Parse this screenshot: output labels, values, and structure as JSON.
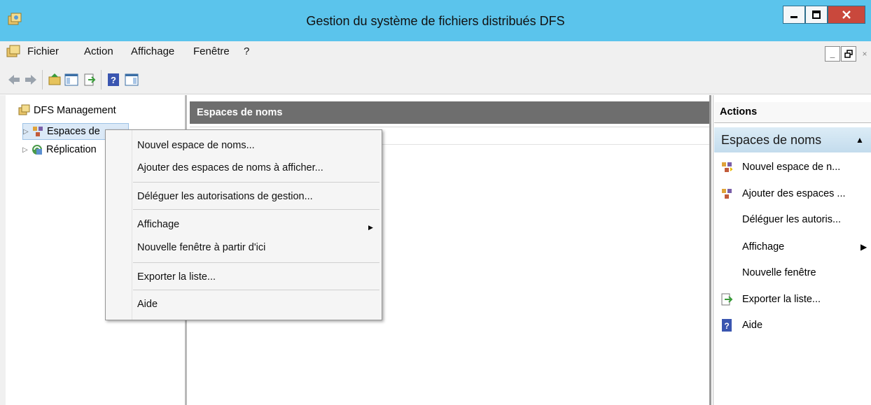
{
  "window": {
    "title": "Gestion du système de fichiers distribués DFS"
  },
  "menubar": {
    "items": [
      "Fichier",
      "Action",
      "Affichage",
      "Fenêtre",
      "?"
    ]
  },
  "tree": {
    "root": "DFS Management",
    "children": [
      "Espaces de",
      "Réplication"
    ]
  },
  "middle": {
    "header": "Espaces de noms"
  },
  "context_menu": {
    "items": [
      "Nouvel espace de noms...",
      "Ajouter des espaces de noms à afficher...",
      "Déléguer les autorisations de gestion...",
      "Affichage",
      "Nouvelle fenêtre à partir d'ici",
      "Exporter la liste...",
      "Aide"
    ]
  },
  "actions": {
    "header": "Actions",
    "section": "Espaces de noms",
    "items": [
      {
        "label": "Nouvel espace de n...",
        "icon": "namespace-new-icon"
      },
      {
        "label": "Ajouter des espaces ...",
        "icon": "namespace-add-icon"
      },
      {
        "label": "Déléguer les autoris...",
        "icon": ""
      },
      {
        "label": "Affichage",
        "icon": ""
      },
      {
        "label": "Nouvelle fenêtre",
        "icon": ""
      },
      {
        "label": "Exporter la liste...",
        "icon": "export-icon"
      },
      {
        "label": "Aide",
        "icon": "help-icon"
      }
    ]
  },
  "colors": {
    "titlebar": "#5bc4ec",
    "close": "#c9483c",
    "header": "#6e6e6e",
    "section": "#c3dced"
  }
}
